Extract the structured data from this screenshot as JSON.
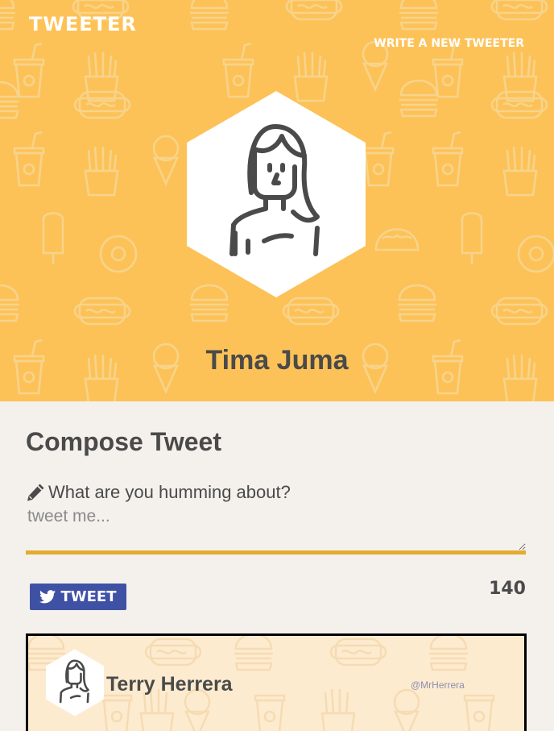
{
  "header": {
    "brand": "TWEETER",
    "write_link": "WRITE A NEW TWEETER",
    "profile_name": "Tima Juma",
    "background_color": "#fdc257"
  },
  "compose": {
    "title": "Compose Tweet",
    "label": "What are you humming about?",
    "placeholder": "tweet me...",
    "value": "",
    "button_label": "TWEET",
    "char_count": "140",
    "button_color": "#3f51a5",
    "underline_color": "#e4ab30"
  },
  "tweets": [
    {
      "name": "Terry Herrera",
      "handle": "@MrHerrera"
    }
  ],
  "icons": {
    "brand_avatar": "woman-avatar-icon",
    "label_icon": "pencil-icon",
    "button_icon": "twitter-bird-icon"
  }
}
